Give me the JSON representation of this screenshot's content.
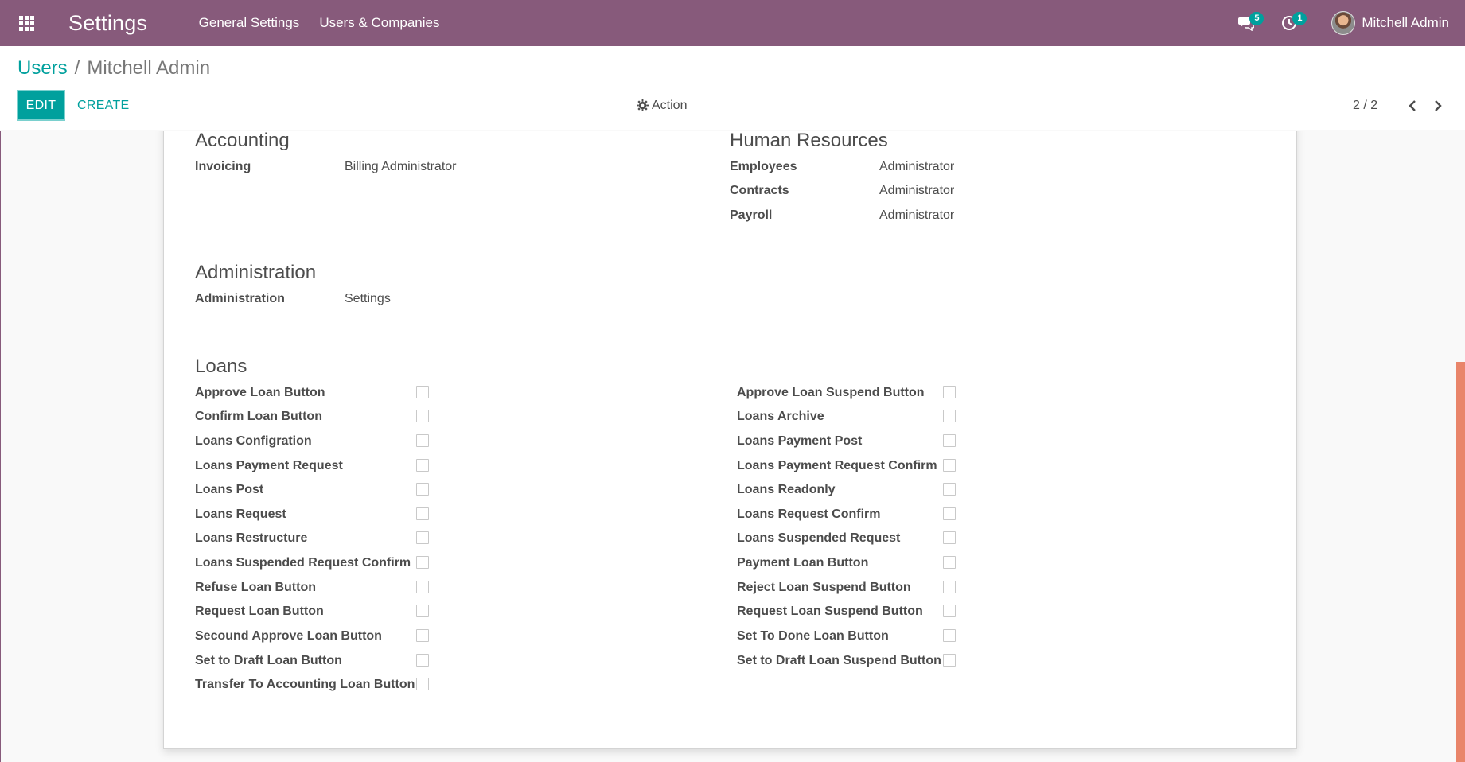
{
  "navbar": {
    "app_title": "Settings",
    "menu": [
      "General Settings",
      "Users & Companies"
    ],
    "messages_count": "5",
    "activities_count": "1",
    "user_name": "Mitchell Admin",
    "color": "#875a7b"
  },
  "breadcrumb": {
    "parent": "Users",
    "separator": "/",
    "current": "Mitchell Admin"
  },
  "buttons": {
    "edit": "EDIT",
    "create": "CREATE",
    "action": "Action"
  },
  "pager": {
    "value": "2 / 2"
  },
  "accounting": {
    "title": "Accounting",
    "fields": [
      {
        "label": "Invoicing",
        "value": "Billing Administrator"
      }
    ]
  },
  "human_resources": {
    "title": "Human Resources",
    "fields": [
      {
        "label": "Employees",
        "value": "Administrator"
      },
      {
        "label": "Contracts",
        "value": "Administrator"
      },
      {
        "label": "Payroll",
        "value": "Administrator"
      }
    ]
  },
  "administration": {
    "title": "Administration",
    "fields": [
      {
        "label": "Administration",
        "value": "Settings"
      }
    ]
  },
  "loans": {
    "title": "Loans",
    "left": [
      {
        "label": "Approve Loan Button",
        "checked": false
      },
      {
        "label": "Confirm Loan Button",
        "checked": false
      },
      {
        "label": "Loans Configration",
        "checked": false
      },
      {
        "label": "Loans Payment Request",
        "checked": false
      },
      {
        "label": "Loans Post",
        "checked": false
      },
      {
        "label": "Loans Request",
        "checked": false
      },
      {
        "label": "Loans Restructure",
        "checked": false
      },
      {
        "label": "Loans Suspended Request Confirm",
        "checked": false
      },
      {
        "label": "Refuse Loan Button",
        "checked": false
      },
      {
        "label": "Request Loan Button",
        "checked": false
      },
      {
        "label": "Secound Approve Loan Button",
        "checked": false
      },
      {
        "label": "Set to Draft Loan Button",
        "checked": false
      },
      {
        "label": "Transfer To Accounting Loan Button",
        "checked": false
      }
    ],
    "right": [
      {
        "label": "Approve Loan Suspend Button",
        "checked": false
      },
      {
        "label": "Loans Archive",
        "checked": false
      },
      {
        "label": "Loans Payment Post",
        "checked": false
      },
      {
        "label": "Loans Payment Request Confirm",
        "checked": false
      },
      {
        "label": "Loans Readonly",
        "checked": false
      },
      {
        "label": "Loans Request Confirm",
        "checked": false
      },
      {
        "label": "Loans Suspended Request",
        "checked": false
      },
      {
        "label": "Payment Loan Button",
        "checked": false
      },
      {
        "label": "Reject Loan Suspend Button",
        "checked": false
      },
      {
        "label": "Request Loan Suspend Button",
        "checked": false
      },
      {
        "label": "Set To Done Loan Button",
        "checked": false
      },
      {
        "label": "Set to Draft Loan Suspend Button",
        "checked": false
      }
    ]
  },
  "colors": {
    "brand": "#875a7b",
    "accent": "#00a09d",
    "scrollbar": "#e9856a"
  }
}
